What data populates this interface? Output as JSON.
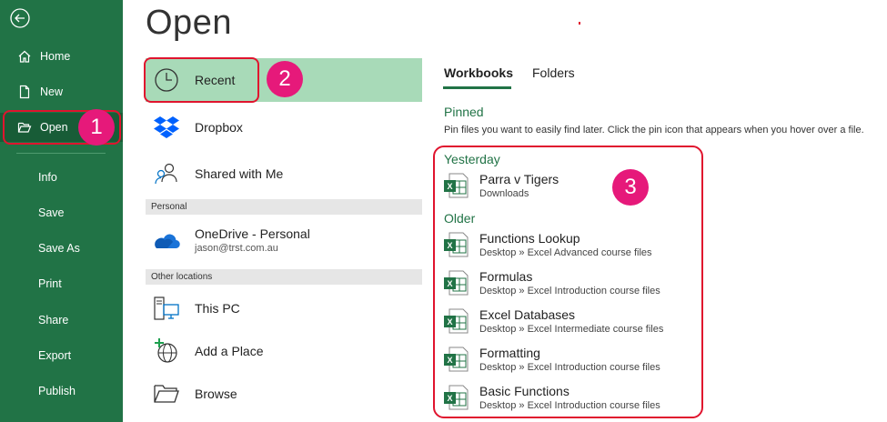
{
  "page_title": "Open",
  "sidebar": {
    "items": [
      {
        "label": "Home",
        "icon": "home-icon"
      },
      {
        "label": "New",
        "icon": "new-document-icon"
      },
      {
        "label": "Open",
        "icon": "folder-open-icon",
        "selected": true
      },
      {
        "label": "Info"
      },
      {
        "label": "Save"
      },
      {
        "label": "Save As"
      },
      {
        "label": "Print"
      },
      {
        "label": "Share"
      },
      {
        "label": "Export"
      },
      {
        "label": "Publish"
      }
    ]
  },
  "locations": {
    "recent": {
      "label": "Recent",
      "icon": "clock-icon"
    },
    "dropbox": {
      "label": "Dropbox",
      "icon": "dropbox-icon"
    },
    "shared": {
      "label": "Shared with Me",
      "icon": "people-icon"
    },
    "personal_header": "Personal",
    "onedrive": {
      "label": "OneDrive - Personal",
      "sub": "jason@trst.com.au",
      "icon": "cloud-icon"
    },
    "other_header": "Other locations",
    "thispc": {
      "label": "This PC",
      "icon": "computer-icon"
    },
    "addplace": {
      "label": "Add a Place",
      "icon": "add-globe-icon"
    },
    "browse": {
      "label": "Browse",
      "icon": "folder-icon"
    }
  },
  "tabs": [
    {
      "label": "Workbooks",
      "active": true
    },
    {
      "label": "Folders"
    }
  ],
  "pinned": {
    "heading": "Pinned",
    "description": "Pin files you want to easily find later. Click the pin icon that appears when you hover over a file."
  },
  "groups": {
    "yesterday": "Yesterday",
    "older": "Older"
  },
  "files": {
    "yesterday": [
      {
        "title": "Parra v Tigers",
        "path": "Downloads"
      }
    ],
    "older": [
      {
        "title": "Functions Lookup",
        "path": "Desktop » Excel Advanced course files"
      },
      {
        "title": "Formulas",
        "path": "Desktop » Excel Introduction course files"
      },
      {
        "title": "Excel Databases",
        "path": "Desktop » Excel Intermediate course files"
      },
      {
        "title": "Formatting",
        "path": "Desktop » Excel Introduction course files"
      },
      {
        "title": "Basic Functions",
        "path": "Desktop » Excel Introduction course files"
      }
    ]
  },
  "annotations": {
    "badge1": "1",
    "badge2": "2",
    "badge3": "3"
  },
  "colors": {
    "excel_green": "#217346",
    "selected_location": "#a8dab8",
    "annotation_red": "#e0142e",
    "badge_pink": "#e6197a"
  }
}
